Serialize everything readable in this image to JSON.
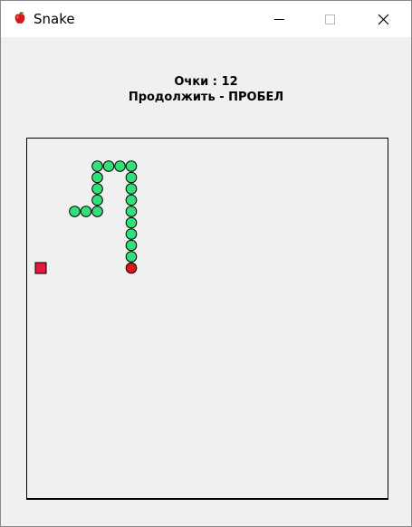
{
  "window": {
    "title": "Snake",
    "icon": "apple-icon",
    "controls": [
      "minimize-icon",
      "maximize-icon",
      "close-icon"
    ]
  },
  "game": {
    "score_text": "Очки : 12",
    "hint_text": "Продолжить - ПРОБЕЛ",
    "score": 12,
    "state": "paused"
  },
  "board": {
    "columns": 16,
    "rows": 16,
    "snake_head": [
      5,
      5
    ],
    "snake_body": [
      [
        5,
        4
      ],
      [
        5,
        3
      ],
      [
        5,
        2
      ],
      [
        5,
        1
      ],
      [
        5,
        0
      ],
      [
        5,
        -1
      ],
      [
        5,
        -2
      ],
      [
        5,
        -3
      ],
      [
        5,
        -4
      ],
      [
        4,
        -4
      ],
      [
        3,
        -4
      ],
      [
        2,
        -4
      ],
      [
        2,
        -3
      ],
      [
        2,
        -2
      ],
      [
        2,
        -1
      ],
      [
        2,
        0
      ],
      [
        1,
        0
      ],
      [
        0,
        0
      ]
    ],
    "food": [
      -3,
      5
    ],
    "colors": {
      "snake_body": "#32e07a",
      "snake_head": "#e01515",
      "food": "#e8183c",
      "board_background": "#f0f0f0",
      "outline": "#000000"
    }
  }
}
